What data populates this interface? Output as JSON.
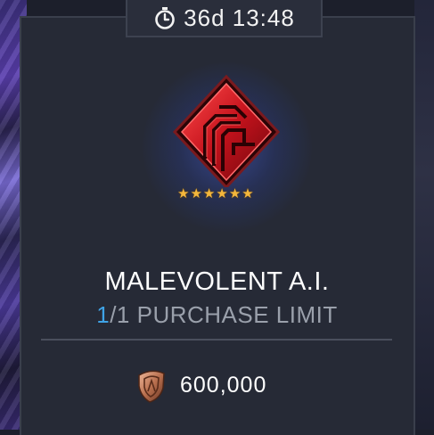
{
  "timer": {
    "icon": "stopwatch-icon",
    "text": "36d 13:48"
  },
  "item": {
    "icon": "malevolent-ai-crystal-icon",
    "stars": [
      "★",
      "★",
      "★",
      "★",
      "★",
      "★"
    ],
    "star_count": 6,
    "title": "MALEVOLENT A.I.",
    "purchase_current": "1",
    "purchase_rest": "/1 PURCHASE LIMIT"
  },
  "price": {
    "icon": "bronze-shield-currency-icon",
    "amount": "600,000"
  },
  "colors": {
    "accent_blue": "#3fa3e6",
    "star_gold": "#f4b73c",
    "crystal_red": "#e01f2a",
    "panel_bg": "#262a36"
  }
}
